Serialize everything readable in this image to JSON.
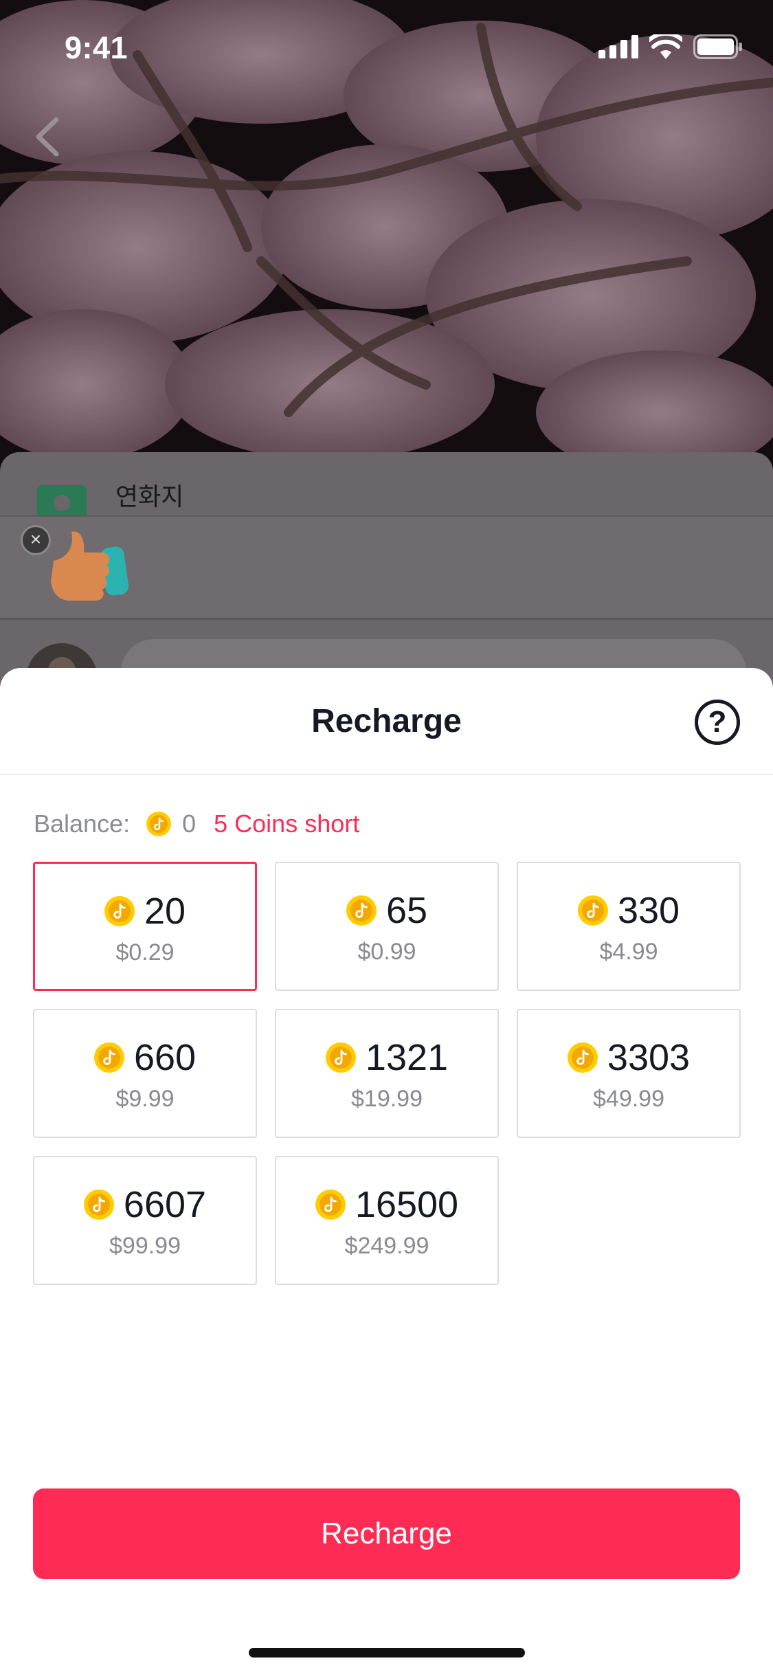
{
  "status_bar": {
    "time": "9:41"
  },
  "background": {
    "shop_name": "연화지"
  },
  "sheet": {
    "title": "Recharge",
    "help_symbol": "?",
    "balance": {
      "label": "Balance:",
      "value": "0",
      "shortfall": "5 Coins short"
    },
    "packages": [
      {
        "coins": "20",
        "price": "$0.29",
        "selected": true
      },
      {
        "coins": "65",
        "price": "$0.99",
        "selected": false
      },
      {
        "coins": "330",
        "price": "$4.99",
        "selected": false
      },
      {
        "coins": "660",
        "price": "$9.99",
        "selected": false
      },
      {
        "coins": "1321",
        "price": "$19.99",
        "selected": false
      },
      {
        "coins": "3303",
        "price": "$49.99",
        "selected": false
      },
      {
        "coins": "6607",
        "price": "$99.99",
        "selected": false
      },
      {
        "coins": "16500",
        "price": "$249.99",
        "selected": false
      }
    ],
    "recharge_button": "Recharge"
  },
  "colors": {
    "accent": "#fe2c55",
    "coin": "#ffcc00",
    "text_primary": "#161823",
    "text_secondary": "#8a8b91"
  },
  "icons": [
    "signal-icon",
    "wifi-icon",
    "battery-icon",
    "back-chevron-icon",
    "help-icon",
    "coin-icon",
    "close-icon",
    "thumbs-up-icon"
  ]
}
